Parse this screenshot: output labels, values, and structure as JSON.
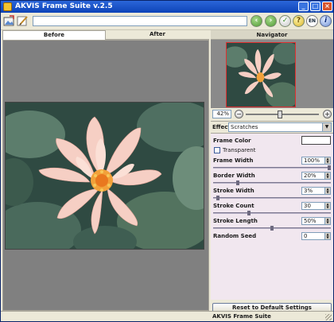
{
  "window": {
    "title": "AKVIS Frame Suite v.2.5"
  },
  "toolbar": {
    "open_icon": "open-image-icon",
    "frame_icon": "frame-brush-icon",
    "lang_label": "EN",
    "info_label": "i"
  },
  "tabs": {
    "before": "Before",
    "after": "After"
  },
  "navigator": {
    "title": "Navigator",
    "zoom_value": "42%",
    "zoom_level": 0.46
  },
  "effect": {
    "label": "Effect",
    "selected": "Scratches"
  },
  "params": {
    "frame_color_label": "Frame Color",
    "frame_color": "#ffffff",
    "transparent_label": "Transparent",
    "transparent_checked": false,
    "frame_width_label": "Frame Width",
    "frame_width_value": "100%",
    "frame_width_level": 1.0,
    "border_width_label": "Border Width",
    "border_width_value": "20%",
    "border_width_level": 0.2,
    "stroke_width_label": "Stroke Width",
    "stroke_width_value": "3%",
    "stroke_width_level": 0.03,
    "stroke_count_label": "Stroke Count",
    "stroke_count_value": "30",
    "stroke_count_level": 0.3,
    "stroke_length_label": "Stroke Length",
    "stroke_length_value": "50%",
    "stroke_length_level": 0.5,
    "random_seed_label": "Random Seed",
    "random_seed_value": "0"
  },
  "reset_button": "Reset to Default Settings",
  "status": {
    "app_name": "AKVIS Frame Suite"
  },
  "colors": {
    "titlebar": "#0d43b8",
    "canvas_bg": "#808080",
    "params_bg": "#f1e7ef",
    "nav_frame": "#e03030"
  }
}
